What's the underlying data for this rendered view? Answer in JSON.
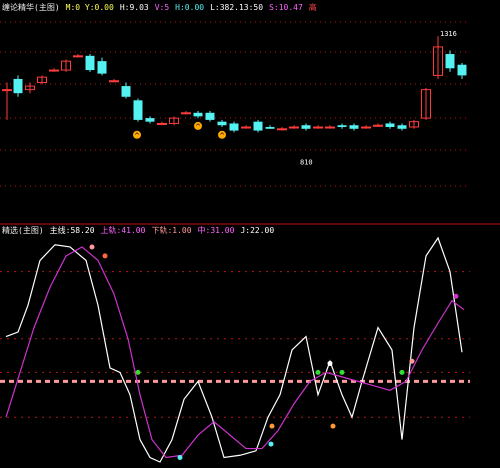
{
  "colors": {
    "bg": "#000000",
    "up": "#ff3b3b",
    "down": "#54f2f2",
    "divider": "#c01010",
    "grid": "#b01818",
    "white": "#ffffff",
    "magenta": "#cc33cc",
    "pink": "#ff9a9a",
    "orange": "#ffaa00",
    "green": "#33dd33",
    "yellow": "#ffee00"
  },
  "top_header": {
    "items": [
      {
        "text": "缠论精华(主图)",
        "color": "#eeeeee"
      },
      {
        "text": "M:0 Y:0.00",
        "color": "#ffff55"
      },
      {
        "text": "H:9.03",
        "color": "#ffffff"
      },
      {
        "text": "V:5",
        "color": "#ff66ff"
      },
      {
        "text": "H:0.00",
        "color": "#54f2f2"
      },
      {
        "text": "L:382.13:50",
        "color": "#ffffff"
      },
      {
        "text": "S:10.47",
        "color": "#ff66ff"
      },
      {
        "text": "高",
        "color": "#ff4444"
      }
    ]
  },
  "bottom_header": {
    "items": [
      {
        "text": "精选(主图)",
        "color": "#eeeeee"
      },
      {
        "text": "主线:58.20",
        "color": "#ffffff"
      },
      {
        "text": "上轨:41.00",
        "color": "#ff66ff"
      },
      {
        "text": "下轨:1.00",
        "color": "#ff9999"
      },
      {
        "text": "中:31.00",
        "color": "#ff66ff"
      },
      {
        "text": "J:22.00",
        "color": "#ffffff"
      }
    ]
  },
  "chart_data": [
    {
      "type": "candlestick",
      "title": "",
      "ylim": [
        0,
        100
      ],
      "annotations": [
        {
          "text": "1316",
          "x": 440,
          "y": 92
        },
        {
          "text": "810",
          "x": 300,
          "y": 20
        }
      ],
      "candles": [
        {
          "x": 7,
          "open": 62,
          "close": 62,
          "high": 66,
          "low": 45
        },
        {
          "x": 18,
          "open": 68,
          "close": 60,
          "high": 70,
          "low": 58
        },
        {
          "x": 30,
          "open": 62,
          "close": 64,
          "high": 66,
          "low": 60
        },
        {
          "x": 42,
          "open": 66,
          "close": 69,
          "high": 70,
          "low": 65
        },
        {
          "x": 54,
          "open": 73,
          "close": 73,
          "high": 74,
          "low": 72
        },
        {
          "x": 66,
          "open": 73,
          "close": 78,
          "high": 79,
          "low": 72
        },
        {
          "x": 78,
          "open": 81,
          "close": 81,
          "high": 82,
          "low": 80
        },
        {
          "x": 90,
          "open": 81,
          "close": 73,
          "high": 82,
          "low": 72
        },
        {
          "x": 102,
          "open": 78,
          "close": 71,
          "high": 80,
          "low": 70
        },
        {
          "x": 114,
          "open": 67,
          "close": 67,
          "high": 68,
          "low": 66
        },
        {
          "x": 126,
          "open": 64,
          "close": 58,
          "high": 66,
          "low": 57
        },
        {
          "x": 138,
          "open": 56,
          "close": 45,
          "high": 57,
          "low": 44
        },
        {
          "x": 150,
          "open": 46,
          "close": 44,
          "high": 47,
          "low": 43
        },
        {
          "x": 162,
          "open": 43,
          "close": 43,
          "high": 44,
          "low": 42
        },
        {
          "x": 174,
          "open": 43,
          "close": 46,
          "high": 47,
          "low": 42
        },
        {
          "x": 186,
          "open": 49,
          "close": 49,
          "high": 50,
          "low": 48
        },
        {
          "x": 198,
          "open": 49,
          "close": 47,
          "high": 50,
          "low": 46
        },
        {
          "x": 210,
          "open": 49,
          "close": 45,
          "high": 50,
          "low": 44
        },
        {
          "x": 222,
          "open": 44,
          "close": 42,
          "high": 45,
          "low": 41
        },
        {
          "x": 234,
          "open": 43,
          "close": 39,
          "high": 44,
          "low": 38
        },
        {
          "x": 246,
          "open": 41,
          "close": 41,
          "high": 42,
          "low": 40
        },
        {
          "x": 258,
          "open": 44,
          "close": 39,
          "high": 45,
          "low": 38
        },
        {
          "x": 270,
          "open": 41,
          "close": 40,
          "high": 42,
          "low": 40
        },
        {
          "x": 282,
          "open": 40,
          "close": 40,
          "high": 41,
          "low": 39
        },
        {
          "x": 294,
          "open": 41,
          "close": 41,
          "high": 42,
          "low": 40
        },
        {
          "x": 306,
          "open": 42,
          "close": 40,
          "high": 43,
          "low": 39
        },
        {
          "x": 318,
          "open": 41,
          "close": 41,
          "high": 42,
          "low": 40
        },
        {
          "x": 330,
          "open": 41,
          "close": 41,
          "high": 42,
          "low": 40
        },
        {
          "x": 342,
          "open": 42,
          "close": 41,
          "high": 43,
          "low": 40
        },
        {
          "x": 354,
          "open": 42,
          "close": 40,
          "high": 43,
          "low": 39
        },
        {
          "x": 366,
          "open": 41,
          "close": 41,
          "high": 42,
          "low": 40
        },
        {
          "x": 378,
          "open": 42,
          "close": 42,
          "high": 43,
          "low": 41
        },
        {
          "x": 390,
          "open": 43,
          "close": 41,
          "high": 44,
          "low": 40
        },
        {
          "x": 402,
          "open": 42,
          "close": 40,
          "high": 43,
          "low": 39
        },
        {
          "x": 414,
          "open": 41,
          "close": 44,
          "high": 45,
          "low": 40
        },
        {
          "x": 426,
          "open": 46,
          "close": 62,
          "high": 63,
          "low": 45
        },
        {
          "x": 438,
          "open": 70,
          "close": 86,
          "high": 92,
          "low": 68
        },
        {
          "x": 450,
          "open": 82,
          "close": 74,
          "high": 84,
          "low": 72
        },
        {
          "x": 462,
          "open": 76,
          "close": 70,
          "high": 77,
          "low": 68
        }
      ],
      "markers": [
        {
          "x": 137,
          "y": 40,
          "color": "#ffaa00",
          "label": "^"
        },
        {
          "x": 198,
          "y": 45,
          "color": "#ffaa00",
          "label": "^"
        },
        {
          "x": 222,
          "y": 40,
          "color": "#ffaa00",
          "label": "^"
        }
      ]
    },
    {
      "type": "line",
      "title": "",
      "ylim": [
        0,
        100
      ],
      "grid_levels": [
        85,
        55,
        40,
        20
      ],
      "series": [
        {
          "color": "#ffffff",
          "points": [
            {
              "x": 6,
              "y": 56
            },
            {
              "x": 18,
              "y": 58
            },
            {
              "x": 28,
              "y": 70
            },
            {
              "x": 40,
              "y": 90
            },
            {
              "x": 55,
              "y": 97
            },
            {
              "x": 70,
              "y": 96
            },
            {
              "x": 86,
              "y": 90
            },
            {
              "x": 98,
              "y": 70
            },
            {
              "x": 110,
              "y": 42
            },
            {
              "x": 120,
              "y": 40
            },
            {
              "x": 130,
              "y": 30
            },
            {
              "x": 140,
              "y": 10
            },
            {
              "x": 150,
              "y": 2
            },
            {
              "x": 160,
              "y": 0
            },
            {
              "x": 172,
              "y": 10
            },
            {
              "x": 184,
              "y": 28
            },
            {
              "x": 198,
              "y": 36
            },
            {
              "x": 212,
              "y": 20
            },
            {
              "x": 224,
              "y": 2
            },
            {
              "x": 240,
              "y": 3
            },
            {
              "x": 256,
              "y": 5
            },
            {
              "x": 268,
              "y": 20
            },
            {
              "x": 280,
              "y": 30
            },
            {
              "x": 292,
              "y": 50
            },
            {
              "x": 306,
              "y": 56
            },
            {
              "x": 318,
              "y": 30
            },
            {
              "x": 330,
              "y": 45
            },
            {
              "x": 342,
              "y": 30
            },
            {
              "x": 352,
              "y": 20
            },
            {
              "x": 362,
              "y": 36
            },
            {
              "x": 378,
              "y": 60
            },
            {
              "x": 392,
              "y": 50
            },
            {
              "x": 402,
              "y": 10
            },
            {
              "x": 414,
              "y": 60
            },
            {
              "x": 426,
              "y": 92
            },
            {
              "x": 438,
              "y": 100
            },
            {
              "x": 450,
              "y": 85
            },
            {
              "x": 462,
              "y": 49
            }
          ]
        },
        {
          "color": "#cc33cc",
          "points": [
            {
              "x": 6,
              "y": 20
            },
            {
              "x": 20,
              "y": 40
            },
            {
              "x": 34,
              "y": 60
            },
            {
              "x": 50,
              "y": 78
            },
            {
              "x": 66,
              "y": 92
            },
            {
              "x": 82,
              "y": 96
            },
            {
              "x": 98,
              "y": 90
            },
            {
              "x": 114,
              "y": 75
            },
            {
              "x": 128,
              "y": 55
            },
            {
              "x": 140,
              "y": 30
            },
            {
              "x": 152,
              "y": 10
            },
            {
              "x": 166,
              "y": 2
            },
            {
              "x": 182,
              "y": 3
            },
            {
              "x": 198,
              "y": 12
            },
            {
              "x": 214,
              "y": 18
            },
            {
              "x": 230,
              "y": 12
            },
            {
              "x": 246,
              "y": 6
            },
            {
              "x": 262,
              "y": 6
            },
            {
              "x": 278,
              "y": 14
            },
            {
              "x": 294,
              "y": 26
            },
            {
              "x": 310,
              "y": 36
            },
            {
              "x": 326,
              "y": 40
            },
            {
              "x": 342,
              "y": 38
            },
            {
              "x": 358,
              "y": 36
            },
            {
              "x": 374,
              "y": 34
            },
            {
              "x": 390,
              "y": 32
            },
            {
              "x": 406,
              "y": 36
            },
            {
              "x": 422,
              "y": 50
            },
            {
              "x": 438,
              "y": 62
            },
            {
              "x": 452,
              "y": 72
            },
            {
              "x": 464,
              "y": 68
            }
          ]
        }
      ],
      "markers": [
        {
          "x": 92,
          "y": 96,
          "color": "#ff9a9a"
        },
        {
          "x": 105,
          "y": 92,
          "color": "#ff6644"
        },
        {
          "x": 138,
          "y": 40,
          "color": "#33dd33"
        },
        {
          "x": 180,
          "y": 2,
          "color": "#54f2f2"
        },
        {
          "x": 271,
          "y": 8,
          "color": "#54f2f2"
        },
        {
          "x": 272,
          "y": 16,
          "color": "#ff9933"
        },
        {
          "x": 318,
          "y": 40,
          "color": "#33dd33"
        },
        {
          "x": 330,
          "y": 44,
          "color": "#ffffff"
        },
        {
          "x": 342,
          "y": 40,
          "color": "#33dd33"
        },
        {
          "x": 333,
          "y": 16,
          "color": "#ff9933"
        },
        {
          "x": 402,
          "y": 40,
          "color": "#33dd33"
        },
        {
          "x": 412,
          "y": 45,
          "color": "#ff9a9a"
        },
        {
          "x": 456,
          "y": 74,
          "color": "#cc33cc"
        }
      ]
    }
  ]
}
